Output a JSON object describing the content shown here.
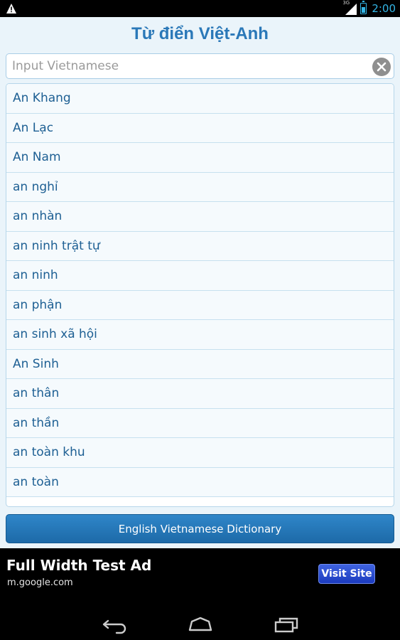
{
  "status_bar": {
    "network": "3G",
    "time": "2:00"
  },
  "app": {
    "title": "Từ điển Việt-Anh"
  },
  "search": {
    "placeholder": "Input Vietnamese",
    "value": ""
  },
  "words": [
    "An Khang",
    "An Lạc",
    "An Nam",
    "an nghỉ",
    "an nhàn",
    "an ninh trật tự",
    "an ninh",
    "an phận",
    "an sinh xã hội",
    "An Sinh",
    "an thân",
    "an thần",
    "an toàn khu",
    "an toàn"
  ],
  "switch_button": {
    "label": "English Vietnamese Dictionary"
  },
  "ad": {
    "title": "Full Width Test Ad",
    "url": "m.google.com",
    "cta": "Visit Site"
  },
  "nav": {
    "icons": [
      "back-icon",
      "home-icon",
      "recent-apps-icon"
    ]
  },
  "colors": {
    "title": "#2a78b8",
    "list_text": "#1d5f93",
    "button": "#1d6aa8",
    "status_accent": "#33b5e5"
  }
}
